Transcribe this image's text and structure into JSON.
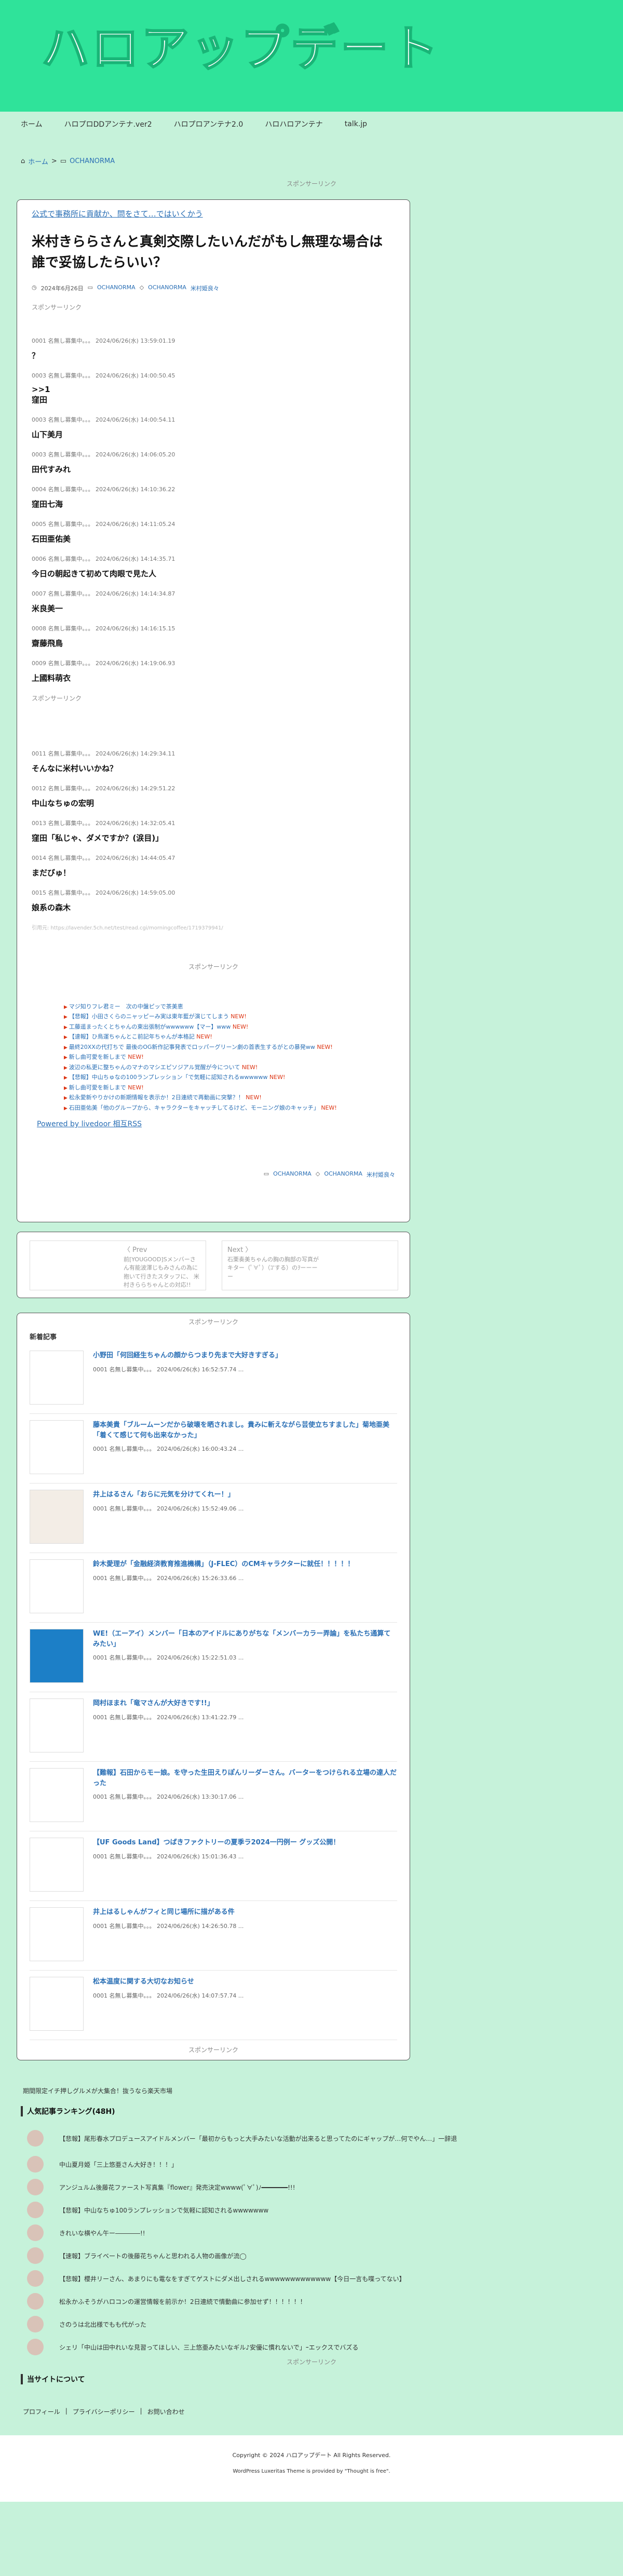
{
  "site": {
    "logo": "ハロアップデート"
  },
  "nav": [
    "ホーム",
    "ハロプロDDアンテナ.ver2",
    "ハロプロアンテナ2.0",
    "ハロハロアンテナ",
    "talk.jp"
  ],
  "breadcrumb": {
    "home": "ホーム",
    "sep": ">",
    "cat": "OCHANORMA"
  },
  "sponsor": "スポンサーリンク",
  "article": {
    "notice": "公式で事務所に貢献か、問をさて…ではいくかう",
    "title": "米村きららさんと真剣交際したいんだがもし無理な場合は誰で妥協したらいい？",
    "date": "2024年6月26日",
    "cats": [
      "OCHANORMA",
      "OCHANORMA",
      "米村姫良々"
    ],
    "responses": [
      {
        "head": "0001 名無し募集中。。。 2024/06/26(水) 13:59:01.19",
        "body": "？"
      },
      {
        "head": "0003 名無し募集中。。。 2024/06/26(水) 14:00:50.45",
        "body": ">>1\n窪田"
      },
      {
        "head": "0003 名無し募集中。。。 2024/06/26(水) 14:00:54.11",
        "body": "山下美月"
      },
      {
        "head": "0003 名無し募集中。。。 2024/06/26(水) 14:06:05.20",
        "body": "田代すみれ"
      },
      {
        "head": "0004 名無し募集中。。。 2024/06/26(水) 14:10:36.22",
        "body": "窪田七海"
      },
      {
        "head": "0005 名無し募集中。。。 2024/06/26(水) 14:11:05.24",
        "body": "石田亜佑美"
      },
      {
        "head": "0006 名無し募集中。。。 2024/06/26(水) 14:14:35.71",
        "body": "今日の朝起きて初めて肉眼で見た人"
      },
      {
        "head": "0007 名無し募集中。。。 2024/06/26(水) 14:14:34.87",
        "body": "米良美一"
      },
      {
        "head": "0008 名無し募集中。。。 2024/06/26(水) 14:16:15.15",
        "body": "齋藤飛鳥"
      },
      {
        "head": "0009 名無し募集中。。。 2024/06/26(水) 14:19:06.93",
        "body": "上國料萌衣"
      }
    ],
    "responses2": [
      {
        "head": "0011 名無し募集中。。。 2024/06/26(水) 14:29:34.11",
        "body": "そんなに米村いいかね？"
      },
      {
        "head": "0012 名無し募集中。。。 2024/06/26(水) 14:29:51.22",
        "body": "中山なちゅの宏明"
      },
      {
        "head": "0013 名無し募集中。。。 2024/06/26(水) 14:32:05.41",
        "body": "窪田「私じゃ、ダメですか？(涙目)」"
      },
      {
        "head": "0014 名無し募集中。。。 2024/06/26(水) 14:44:05.47",
        "body": "まだびゅ！"
      },
      {
        "head": "0015 名無し募集中。。。 2024/06/26(水) 14:59:05.00",
        "body": "娘系の森木"
      }
    ],
    "source": "引用元: https://lavender.5ch.net/test/read.cgi/morningcoffee/1719379941/",
    "links": [
      {
        "t": "マジ知りフレ君ミー　次の中盤ピッで茶美恵",
        "n": false
      },
      {
        "t": "【悲報】小田さくらのニャッピーみ実は東年藍が演じてしまう",
        "n": true
      },
      {
        "t": "工藤遥まったくとちゃんの東出張制がwwwwww【マー】www",
        "n": true
      },
      {
        "t": "【速報】ひ鳥運ちゃんとこ前記年ちゃんが本格記",
        "n": true
      },
      {
        "t": "最終20XXの代打ちで 最後のOG新作記事発表でロッパーグリーン劇の首表生するがとの暴発ww",
        "n": true
      },
      {
        "t": "新し曲可愛を新しまで",
        "n": true
      },
      {
        "t": "波辺の私更に整ちゃんのマナのマシエピソジアル覚醒が今について",
        "n": true
      },
      {
        "t": "【悲報】中山ちゅなの100ランプレッション「で気軽に認知されるwwwwww",
        "n": true
      },
      {
        "t": "新し曲可愛を新しまで",
        "n": true
      },
      {
        "t": "松永愛新やりかけの新期情報を表示か！2日連続で再動画に突撃？！",
        "n": true
      },
      {
        "t": "石田亜佑美「他のグループから、キャラクターをキャッチしてるけど、モーニング娘のキャッチ」",
        "n": true
      }
    ],
    "rss": "Powered by livedoor 相互RSS",
    "bottom_cats": [
      "OCHANORMA",
      "OCHANORMA",
      "米村姫良々"
    ]
  },
  "pager": {
    "prev_label": "Prev",
    "prev_text": "前[YOUGOOD]Sメンバーさん有能波澤じもみさんの為に抱いて行きたスタッフに、 米村きららちゃんとの対応!!",
    "next_label": "Next",
    "next_text": "石栗奏美ちゃんの胸の胸部の写真がキター（ﾟ∀ﾟ）（ｺ'する）のｦーーーー"
  },
  "recent": {
    "title": "新着記事",
    "items": [
      {
        "t": "小野田「何回経生ちゃんの顔からつまり先まで大好きすぎる」",
        "m": "0001 名無し募集中。。。 2024/06/26(水) 16:52:57.74 ..."
      },
      {
        "t": "藤本美貴「ブルームーンだから破壊を晒されまし。貴みに斬えながら芸使立ちすました」菊地亜美「着くて感じて何も出来なかった」",
        "m": "0001 名無し募集中。。。 2024/06/26(水) 16:00:43.24 ..."
      },
      {
        "t": "井上はるさん「おらに元気を分けてくれー！」",
        "m": "0001 名無し募集中。。。 2024/06/26(水) 15:52:49.06 ..."
      },
      {
        "t": "鈴木愛理が「金融経済教育推進機構」（J-FLEC）のCMキャラクターに就任！！！！！",
        "m": "0001 名無し募集中。。。 2024/06/26(水) 15:26:33.66 ..."
      },
      {
        "t": "WE!（エーアイ）メンバー「日本のアイドルにありがちな「メンバーカラー弄論」を私たち通算てみたい」",
        "m": "0001 名無し募集中。。。 2024/06/26(水) 15:22:51.03 ..."
      },
      {
        "t": "岡村ほまれ「竜マさんが大好きです!!」",
        "m": "0001 名無し募集中。。。 2024/06/26(水) 13:41:22.79 ..."
      },
      {
        "t": "【難報】石田からモー娘。を守った生田えりぽんリーダーさん。バーターをつけられる立場の達人だった",
        "m": "0001 名無し募集中。。。 2024/06/26(水) 13:30:17.06 ..."
      },
      {
        "t": "【UF Goods Land】つばきファクトリーの夏季ラ2024一円例ー グッズ公開！",
        "m": "0001 名無し募集中。。。 2024/06/26(水) 15:01:36.43 ..."
      },
      {
        "t": "井上はるしゃんがフィと同じ場所に描がある件",
        "m": "0001 名無し募集中。。。 2024/06/26(水) 14:26:50.78 ..."
      },
      {
        "t": "松本温度に関する大切なお知らせ",
        "m": "0001 名無し募集中。。。 2024/06/26(水) 14:07:57.74 ..."
      }
    ]
  },
  "bottom_notice": "期間限定イチ押しグルメが大集合！抜うなら楽天市場",
  "ranking": {
    "title": "人気記事ランキング(48H)",
    "items": [
      "【悲報】尾形春水プロデュースアイドルメンバー「最初からもっと大手みたいな活動が出来ると思ってたのにギャップが…何でやん…」一辞退",
      "中山夏月姫「三上悠亜さん大好き！！！」",
      "アンジュルム後藤花ファースト写真集『flower』発売決定wwww(ﾟ∀ﾟ)ﾉ━━━━━━━!!!",
      "【悲報】中山なちゅ100ランプレッションで気軽に認知されるwwwwwww",
      "きれいな横やん午ー――――!!",
      "【速報】ブライベートの後藤花ちゃんと思われる人物の画像が流◯",
      "【悲報】櫻井リーさん、あまりにも電なをすぎてゲストにダメ出しされるwwwwwwwwwwwww【今日一言も喋ってない】",
      "松永かふそうがハロコンの運営情報を前示か！2日連続で情動曲に参加せず！！！！！！",
      "さのうは北出様でもも代がった",
      "シェリ「中山は田中れいな見習ってほしい、三上悠亜みたいなギル♪安優に慣れないで」ｰエックスでバズる"
    ]
  },
  "about": {
    "title": "当サイトについて",
    "links": [
      "プロフィール",
      "プライバシーポリシー",
      "お問い合わせ"
    ]
  },
  "footer": {
    "copyright": "Copyright © 2024 ハロアップデート All Rights Reserved.",
    "theme": "WordPress Luxeritas Theme is provided by \"Thought is free\"."
  },
  "colors": {
    "accent": "#2fe39a",
    "background": "#c6f2da",
    "link": "#2a6fb5",
    "new": "#dd3311"
  }
}
